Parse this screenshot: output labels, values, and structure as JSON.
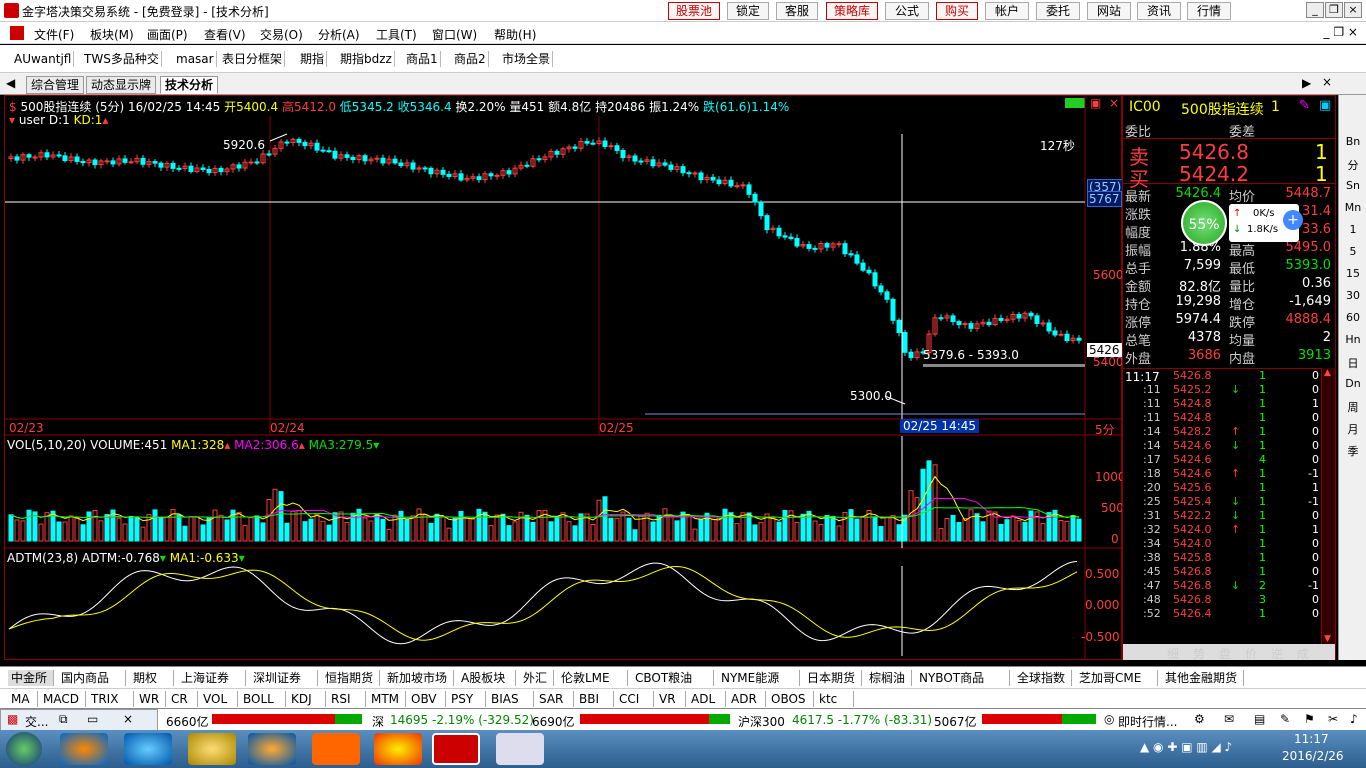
{
  "window": {
    "title": "金字塔决策交易系统 - [免费登录] - [技术分析]"
  },
  "top_buttons": [
    "股票池",
    "锁定",
    "客服",
    "策略库",
    "公式",
    "购买",
    "帐户",
    "委托",
    "网站",
    "资讯",
    "行情"
  ],
  "menus": [
    "文件(F)",
    "板块(M)",
    "画面(P)",
    "查看(V)",
    "交易(O)",
    "分析(A)",
    "工具(T)",
    "窗口(W)",
    "帮助(H)"
  ],
  "toolbar": [
    "AUwantjfl",
    "TWS多品种交",
    "masar",
    "表日分框架",
    "期指",
    "期指bdzz",
    "商品1",
    "商品2",
    "市场全景"
  ],
  "tabs": [
    "综合管理",
    "动态显示牌",
    "技术分析"
  ],
  "chart_header": {
    "symbol": "500股指连续 (5分)",
    "datetime": "16/02/25 14:45",
    "open": "开5400.4",
    "high": "高5412.0",
    "low": "低5345.2",
    "close": "收5346.4",
    "turnover": "换2.20%",
    "vol": "量451",
    "amount": "额4.8亿",
    "oi": "持20486",
    "amp": "振1.24%",
    "chg": "跌(61.6)1.14%",
    "user": "user D:1",
    "kd": "KD:1"
  },
  "price_panel": {
    "annot_high": "5920.6",
    "annot_low": "5300.0",
    "range_label": "5379.6 - 5393.0",
    "timer": "127秒",
    "y_ticks": [
      "5600",
      "5400"
    ],
    "cursor_tag1": "(357)",
    "cursor_tag2": "5767",
    "last_tag": "5426",
    "x_ticks": [
      "02/23",
      "02/24",
      "02/25"
    ],
    "cursor_x": "02/25 14:45",
    "period": "5分"
  },
  "vol_panel": {
    "label": "VOL(5,10,20)",
    "vol": "VOLUME:451",
    "ma1": "MA1:328",
    "ma2": "MA2:306.6",
    "ma3": "MA3:279.5",
    "y_ticks": [
      "1000",
      "500",
      "0"
    ]
  },
  "adtm_panel": {
    "label": "ADTM(23,8)",
    "adtm": "ADTM:-0.768",
    "ma1": "MA1:-0.633",
    "y_ticks": [
      "0.500",
      "0.000",
      "-0.500"
    ]
  },
  "quote": {
    "code": "IC00",
    "name": "500股指连续",
    "num": "1",
    "ask_label": "委比",
    "bid_label": "委差",
    "sell": "卖",
    "sell_price": "5426.8",
    "sell_qty": "1",
    "buy": "买",
    "buy_price": "5424.2",
    "buy_qty": "1",
    "rows": [
      [
        "最新",
        "5426.4",
        "均价",
        "5448.7"
      ],
      [
        "涨跌",
        "",
        "",
        "31.4"
      ],
      [
        "幅度",
        "",
        "",
        "33.6"
      ],
      [
        "振幅",
        "1.88%",
        "最高",
        "5495.0"
      ],
      [
        "总手",
        "7,599",
        "最低",
        "5393.0"
      ],
      [
        "金额",
        "82.8亿",
        "量比",
        "0.36"
      ],
      [
        "持仓",
        "19,298",
        "增仓",
        "-1,649"
      ],
      [
        "涨停",
        "5974.4",
        "跌停",
        "4888.4"
      ],
      [
        "总笔",
        "4378",
        "均量",
        "2"
      ],
      [
        "外盘",
        "3686",
        "内盘",
        "3913"
      ]
    ],
    "net_pct": "55%",
    "net_up": "0K/s",
    "net_dn": "1.8K/s",
    "ticks_time": "11:17",
    "ticks": [
      [
        "",
        "5426.8",
        "",
        "1",
        "0"
      ],
      [
        ":11",
        "5425.2",
        "↓",
        "1",
        "0"
      ],
      [
        ":11",
        "5424.8",
        "",
        "1",
        "1"
      ],
      [
        ":11",
        "5424.8",
        "",
        "1",
        "0"
      ],
      [
        ":14",
        "5428.2",
        "↑",
        "1",
        "0"
      ],
      [
        ":14",
        "5424.6",
        "↓",
        "1",
        "0"
      ],
      [
        ":17",
        "5424.6",
        "",
        "4",
        "0"
      ],
      [
        ":18",
        "5424.6",
        "↑",
        "1",
        "-1"
      ],
      [
        ":20",
        "5425.6",
        "",
        "1",
        "1"
      ],
      [
        ":25",
        "5425.4",
        "↓",
        "1",
        "-1"
      ],
      [
        ":31",
        "5422.2",
        "↓",
        "1",
        "0"
      ],
      [
        ":32",
        "5424.0",
        "↑",
        "1",
        "1"
      ],
      [
        ":34",
        "5424.0",
        "",
        "1",
        "0"
      ],
      [
        ":38",
        "5425.8",
        "",
        "1",
        "0"
      ],
      [
        ":45",
        "5426.8",
        "",
        "1",
        "0"
      ],
      [
        ":47",
        "5426.8",
        "↓",
        "2",
        "-1"
      ],
      [
        ":48",
        "5426.8",
        "",
        "3",
        "0"
      ],
      [
        ":52",
        "5426.4",
        "",
        "1",
        "0"
      ]
    ],
    "bottom_tabs": [
      "细",
      "势",
      "盘",
      "价",
      "逆",
      "成"
    ]
  },
  "sidebar": [
    "Bn",
    "分",
    "Sn",
    "Mn",
    "1",
    "5",
    "15",
    "30",
    "60",
    "Hn",
    "日",
    "Dn",
    "周",
    "月",
    "季"
  ],
  "market_tabs": [
    "中金所",
    "国内商品",
    "期权",
    "上海证券",
    "深圳证券",
    "恒指期货",
    "新加坡市场",
    "A股板块",
    "外汇",
    "伦敦LME",
    "CBOT粮油",
    "NYME能源",
    "日本期货",
    "棕榈油",
    "NYBOT商品",
    "全球指数",
    "芝加哥CME",
    "其他金融期货"
  ],
  "indicator_tabs": [
    "MA",
    "MACD",
    "TRIX",
    "WR",
    "CR",
    "VOL",
    "BOLL",
    "KDJ",
    "RSI",
    "MTM",
    "OBV",
    "PSY",
    "BIAS",
    "SAR",
    "BBI",
    "CCI",
    "VR",
    "ADL",
    "ADR",
    "OBOS",
    "ktc"
  ],
  "status": {
    "task": "交...",
    "sh_amount": "6660亿",
    "sz_label": "深",
    "sz": "14695 -2.19% (-329.52)",
    "sz_amount": "6690亿",
    "hs_label": "沪深300",
    "hs": "4617.5 -1.77% (-83.31)",
    "hs_amount": "5067亿",
    "news": "即时行情..."
  },
  "clock": {
    "time": "11:17",
    "date": "2016/2/26"
  },
  "colors": {
    "up": "#ff3c3c",
    "down": "#00ffff",
    "bg": "#000000",
    "frame": "#800000"
  }
}
